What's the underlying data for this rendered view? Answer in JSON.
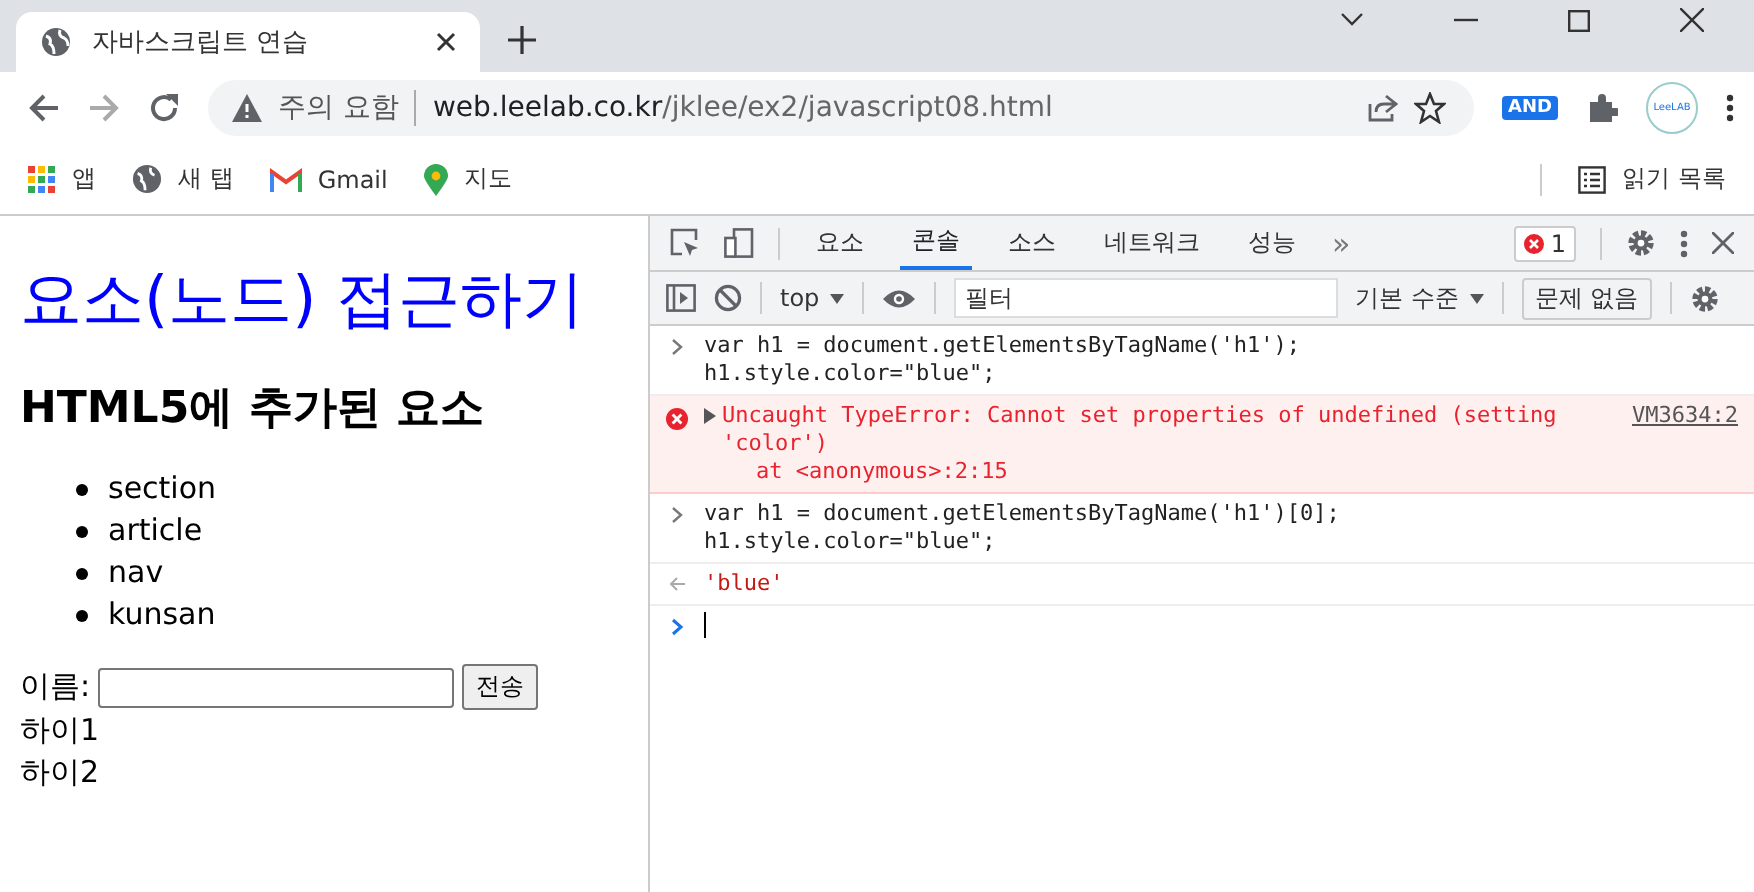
{
  "browser": {
    "tab": {
      "title": "자바스크립트 연습",
      "selected": true
    },
    "security_label": "주의 요함",
    "url_host": "web.leelab.co.kr",
    "url_path": "/jklee/ex2/javascript08.html",
    "extension_badge": "AND",
    "profile_label": "LeeLAB",
    "bookmarks": [
      {
        "kind": "apps",
        "label": "앱"
      },
      {
        "kind": "globe",
        "label": "새 탭"
      },
      {
        "kind": "gmail",
        "label": "Gmail"
      },
      {
        "kind": "maps",
        "label": "지도"
      }
    ],
    "reading_list": "읽기 목록"
  },
  "page": {
    "heading": "요소(노드) 접근하기",
    "subheading": "HTML5에 추가된 요소",
    "list_items": [
      "section",
      "article",
      "nav",
      "kunsan"
    ],
    "form": {
      "label": "이름:",
      "button": "전송"
    },
    "lines": [
      "하이1",
      "하이2"
    ]
  },
  "devtools": {
    "tabs": [
      {
        "label": "요소",
        "selected": false
      },
      {
        "label": "콘솔",
        "selected": true
      },
      {
        "label": "소스",
        "selected": false
      },
      {
        "label": "네트워크",
        "selected": false
      },
      {
        "label": "성능",
        "selected": false
      }
    ],
    "more_tabs": "»",
    "error_count": "1",
    "context": "top",
    "filter": {
      "placeholder": "필터"
    },
    "level_menu": "기본 수준",
    "issues_button": "문제 없음",
    "console": [
      {
        "kind": "input",
        "lines": [
          "var h1 = document.getElementsByTagName('h1');",
          "h1.style.color=\"blue\";"
        ]
      },
      {
        "kind": "error",
        "message": "Uncaught TypeError: Cannot set properties of undefined (setting 'color')",
        "source": "VM3634:2",
        "stack": "at <anonymous>:2:15"
      },
      {
        "kind": "input",
        "lines": [
          "var h1 = document.getElementsByTagName('h1')[0];",
          "h1.style.color=\"blue\";"
        ]
      },
      {
        "kind": "result",
        "value": "'blue'"
      },
      {
        "kind": "prompt"
      }
    ]
  }
}
